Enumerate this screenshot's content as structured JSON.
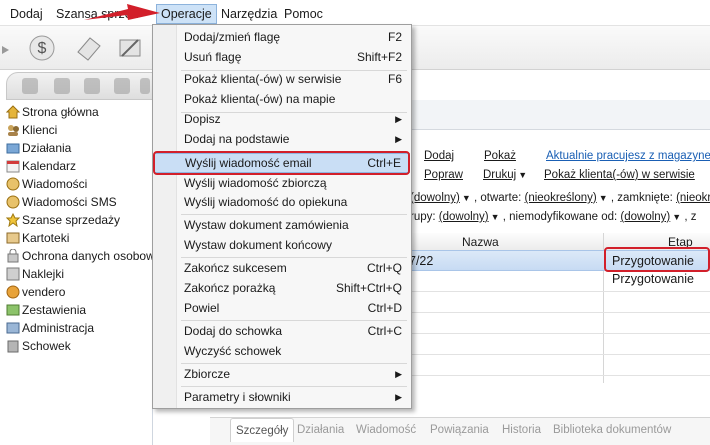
{
  "menubar": {
    "items": [
      "Dodaj",
      "Szansa sprzed",
      "Operacje",
      "Narzędzia",
      "Pomoc"
    ]
  },
  "sidebar": {
    "items": [
      {
        "label": "Strona główna",
        "icon": "home-icon"
      },
      {
        "label": "Klienci",
        "icon": "clients-icon"
      },
      {
        "label": "Działania",
        "icon": "actions-icon"
      },
      {
        "label": "Kalendarz",
        "icon": "calendar-icon"
      },
      {
        "label": "Wiadomości",
        "icon": "messages-icon"
      },
      {
        "label": "Wiadomości SMS",
        "icon": "sms-icon"
      },
      {
        "label": "Szanse sprzedaży",
        "icon": "sales-opportunity-icon"
      },
      {
        "label": "Kartoteki",
        "icon": "cards-icon"
      },
      {
        "label": "Ochrona danych osobow",
        "icon": "data-protection-icon"
      },
      {
        "label": "Naklejki",
        "icon": "stickers-icon"
      },
      {
        "label": "vendero",
        "icon": "vendero-icon"
      },
      {
        "label": "Zestawienia",
        "icon": "reports-icon"
      },
      {
        "label": "Administracja",
        "icon": "admin-icon"
      },
      {
        "label": "Schowek",
        "icon": "clipboard-icon"
      }
    ]
  },
  "actions": {
    "row1": {
      "dodaj": "Dodaj",
      "pokaz": "Pokaż",
      "aktualnie": "Aktualnie pracujesz z magazynem"
    },
    "row2": {
      "popraw": "Popraw",
      "drukuj": "Drukuj",
      "pokaz_klienta": "Pokaż klienta(-ów) w serwisie"
    }
  },
  "filters": {
    "row1": {
      "v1": "(dowolny)",
      "otwarte_label": ", otwarte:",
      "v2": "(nieokreślony)",
      "zamkniete_label": ", zamknięte:",
      "v3": "(nieokr"
    },
    "row2": {
      "prefix": "rupy:",
      "v1": "(dowolny)",
      "mid": ", niemodyfikowane od:",
      "v2": "(dowolny)",
      "suffix": ", z"
    }
  },
  "grid": {
    "columns": [
      "Nazwa",
      "Etap"
    ],
    "rows": [
      {
        "nazwa": "7/22",
        "etap": "Przygotowanie"
      },
      {
        "nazwa": "",
        "etap": "Przygotowanie"
      }
    ]
  },
  "bottom_tabs": [
    "Szczegóły",
    "Działania",
    "Wiadomość",
    "Powiązania",
    "Historia",
    "Biblioteka dokumentów"
  ],
  "dropdown": {
    "items": [
      {
        "label": "Dodaj/zmień flagę",
        "shortcut": "F2"
      },
      {
        "label": "Usuń flagę",
        "shortcut": "Shift+F2"
      },
      {
        "label": "Pokaż klienta(-ów) w serwisie",
        "shortcut": "F6"
      },
      {
        "label": "Pokaż klienta(-ów) na mapie",
        "shortcut": ""
      },
      {
        "label": "Dopisz",
        "shortcut": "",
        "submenu": true
      },
      {
        "label": "Dodaj na podstawie",
        "shortcut": "",
        "submenu": true
      },
      {
        "label": "Wyślij wiadomość email",
        "shortcut": "Ctrl+E",
        "highlighted": true
      },
      {
        "label": "Wyślij wiadomość zbiorczą",
        "shortcut": ""
      },
      {
        "label": "Wyślij wiadomość do opiekuna",
        "shortcut": ""
      },
      {
        "label": "Wystaw dokument zamówienia",
        "shortcut": ""
      },
      {
        "label": "Wystaw dokument końcowy",
        "shortcut": ""
      },
      {
        "label": "Zakończ sukcesem",
        "shortcut": "Ctrl+Q"
      },
      {
        "label": "Zakończ porażką",
        "shortcut": "Shift+Ctrl+Q"
      },
      {
        "label": "Powiel",
        "shortcut": "Ctrl+D"
      },
      {
        "label": "Dodaj do schowka",
        "shortcut": "Ctrl+C"
      },
      {
        "label": "Wyczyść schowek",
        "shortcut": ""
      },
      {
        "label": "Zbiorcze",
        "shortcut": "",
        "submenu": true
      },
      {
        "label": "Parametry i słowniki",
        "shortcut": "",
        "submenu": true
      }
    ]
  },
  "colors": {
    "highlight_red": "#d21f2a",
    "menu_hover": "#c9def5",
    "link_blue": "#1a5fb4"
  }
}
